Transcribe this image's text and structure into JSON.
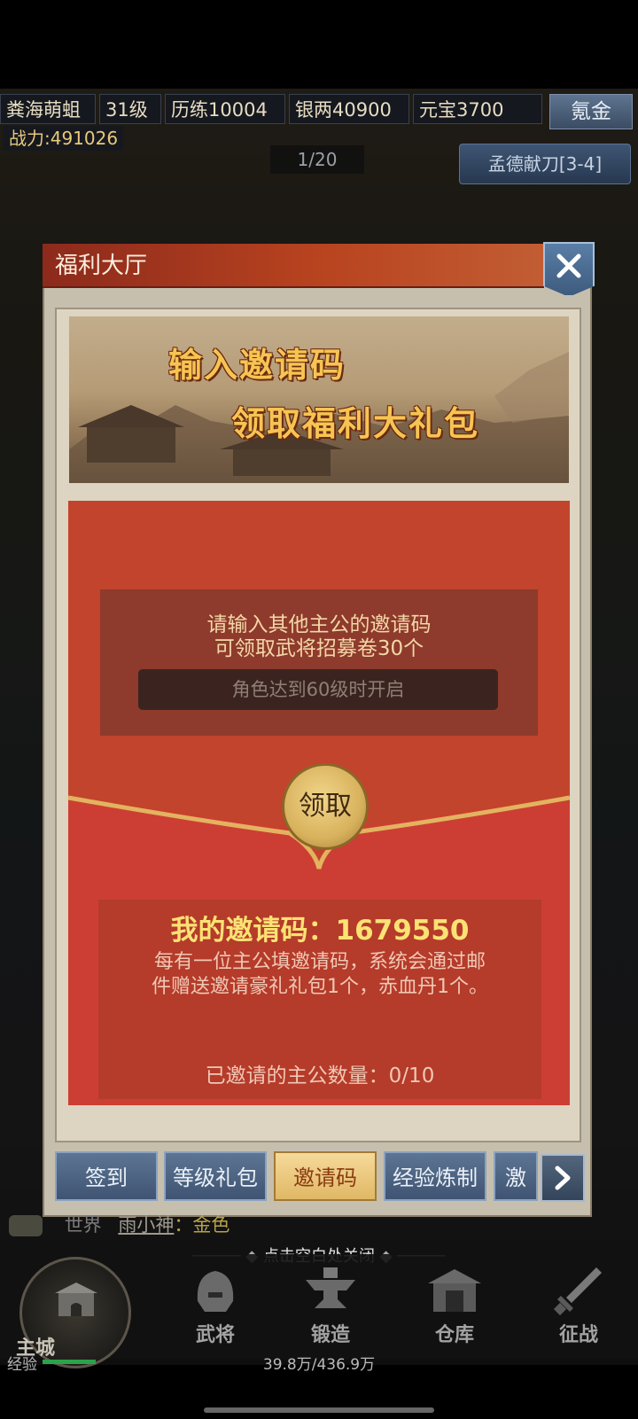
{
  "status_bar": {
    "player_name": "粪海萌蛆",
    "level": "31级",
    "experience": "历练10004",
    "silver": "银两40900",
    "yuanbao": "元宝3700",
    "recharge_label": "氪金",
    "power": "战力:491026",
    "page_indicator": "1/20",
    "stage_label": "孟德献刀[3-4]"
  },
  "modal": {
    "title": "福利大厅",
    "banner_line1": "输入邀请码",
    "banner_line2": "领取福利大礼包",
    "input_hint_line1": "请输入其他主公的邀请码",
    "input_hint_line2": "可领取武将招募卷30个",
    "input_placeholder": "角色达到60级时开启",
    "claim_label": "领取",
    "my_code_label": "我的邀请码：1679550",
    "code_desc_line1": "每有一位主公填邀请码，系统会通过邮",
    "code_desc_line2": "件赠送邀请豪礼礼包1个，赤血丹1个。",
    "invite_count": "已邀请的主公数量：0/10"
  },
  "tabs": [
    {
      "label": "签到",
      "active": false
    },
    {
      "label": "等级礼包",
      "active": false
    },
    {
      "label": "邀请码",
      "active": true
    },
    {
      "label": "经验炼制",
      "active": false
    },
    {
      "label": "激",
      "active": false
    }
  ],
  "chat": {
    "channel": "世界",
    "name": "雨小神",
    "message": "：金色"
  },
  "close_hint": "点击空白处关闭",
  "nav": [
    {
      "label": "主城",
      "icon": "city-gate-icon"
    },
    {
      "label": "武将",
      "icon": "helmet-icon"
    },
    {
      "label": "锻造",
      "icon": "anvil-icon"
    },
    {
      "label": "仓库",
      "icon": "warehouse-icon"
    },
    {
      "label": "征战",
      "icon": "sword-icon"
    }
  ],
  "exp": {
    "label": "经验",
    "value": "39.8万/436.9万"
  }
}
